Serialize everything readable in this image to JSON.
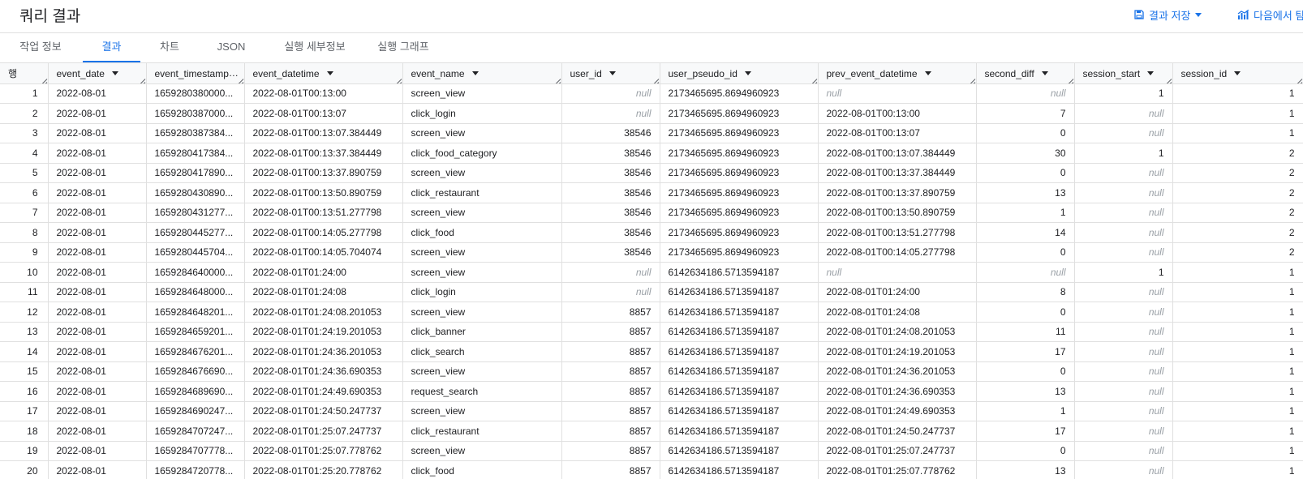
{
  "header": {
    "title": "쿼리 결과",
    "save_label": "결과 저장",
    "explore_label": "다음에서 탐색"
  },
  "tabs": [
    {
      "label": "작업 정보",
      "active": false
    },
    {
      "label": "결과",
      "active": true
    },
    {
      "label": "차트",
      "active": false
    },
    {
      "label": "JSON",
      "active": false
    },
    {
      "label": "실행 세부정보",
      "active": false
    },
    {
      "label": "실행 그래프",
      "active": false
    }
  ],
  "table": {
    "row_header": "행",
    "columns": [
      "event_date",
      "event_timestamp",
      "event_datetime",
      "event_name",
      "user_id",
      "user_pseudo_id",
      "prev_event_datetime",
      "second_diff",
      "session_start",
      "session_id"
    ],
    "rows": [
      [
        "1",
        "2022-08-01",
        "1659280380000...",
        "2022-08-01T00:13:00",
        "screen_view",
        "null",
        "2173465695.8694960923",
        "null",
        "null",
        "1",
        "1"
      ],
      [
        "2",
        "2022-08-01",
        "1659280387000...",
        "2022-08-01T00:13:07",
        "click_login",
        "null",
        "2173465695.8694960923",
        "2022-08-01T00:13:00",
        "7",
        "null",
        "1"
      ],
      [
        "3",
        "2022-08-01",
        "1659280387384...",
        "2022-08-01T00:13:07.384449",
        "screen_view",
        "38546",
        "2173465695.8694960923",
        "2022-08-01T00:13:07",
        "0",
        "null",
        "1"
      ],
      [
        "4",
        "2022-08-01",
        "1659280417384...",
        "2022-08-01T00:13:37.384449",
        "click_food_category",
        "38546",
        "2173465695.8694960923",
        "2022-08-01T00:13:07.384449",
        "30",
        "1",
        "2"
      ],
      [
        "5",
        "2022-08-01",
        "1659280417890...",
        "2022-08-01T00:13:37.890759",
        "screen_view",
        "38546",
        "2173465695.8694960923",
        "2022-08-01T00:13:37.384449",
        "0",
        "null",
        "2"
      ],
      [
        "6",
        "2022-08-01",
        "1659280430890...",
        "2022-08-01T00:13:50.890759",
        "click_restaurant",
        "38546",
        "2173465695.8694960923",
        "2022-08-01T00:13:37.890759",
        "13",
        "null",
        "2"
      ],
      [
        "7",
        "2022-08-01",
        "1659280431277...",
        "2022-08-01T00:13:51.277798",
        "screen_view",
        "38546",
        "2173465695.8694960923",
        "2022-08-01T00:13:50.890759",
        "1",
        "null",
        "2"
      ],
      [
        "8",
        "2022-08-01",
        "1659280445277...",
        "2022-08-01T00:14:05.277798",
        "click_food",
        "38546",
        "2173465695.8694960923",
        "2022-08-01T00:13:51.277798",
        "14",
        "null",
        "2"
      ],
      [
        "9",
        "2022-08-01",
        "1659280445704...",
        "2022-08-01T00:14:05.704074",
        "screen_view",
        "38546",
        "2173465695.8694960923",
        "2022-08-01T00:14:05.277798",
        "0",
        "null",
        "2"
      ],
      [
        "10",
        "2022-08-01",
        "1659284640000...",
        "2022-08-01T01:24:00",
        "screen_view",
        "null",
        "6142634186.5713594187",
        "null",
        "null",
        "1",
        "1"
      ],
      [
        "11",
        "2022-08-01",
        "1659284648000...",
        "2022-08-01T01:24:08",
        "click_login",
        "null",
        "6142634186.5713594187",
        "2022-08-01T01:24:00",
        "8",
        "null",
        "1"
      ],
      [
        "12",
        "2022-08-01",
        "1659284648201...",
        "2022-08-01T01:24:08.201053",
        "screen_view",
        "8857",
        "6142634186.5713594187",
        "2022-08-01T01:24:08",
        "0",
        "null",
        "1"
      ],
      [
        "13",
        "2022-08-01",
        "1659284659201...",
        "2022-08-01T01:24:19.201053",
        "click_banner",
        "8857",
        "6142634186.5713594187",
        "2022-08-01T01:24:08.201053",
        "11",
        "null",
        "1"
      ],
      [
        "14",
        "2022-08-01",
        "1659284676201...",
        "2022-08-01T01:24:36.201053",
        "click_search",
        "8857",
        "6142634186.5713594187",
        "2022-08-01T01:24:19.201053",
        "17",
        "null",
        "1"
      ],
      [
        "15",
        "2022-08-01",
        "1659284676690...",
        "2022-08-01T01:24:36.690353",
        "screen_view",
        "8857",
        "6142634186.5713594187",
        "2022-08-01T01:24:36.201053",
        "0",
        "null",
        "1"
      ],
      [
        "16",
        "2022-08-01",
        "1659284689690...",
        "2022-08-01T01:24:49.690353",
        "request_search",
        "8857",
        "6142634186.5713594187",
        "2022-08-01T01:24:36.690353",
        "13",
        "null",
        "1"
      ],
      [
        "17",
        "2022-08-01",
        "1659284690247...",
        "2022-08-01T01:24:50.247737",
        "screen_view",
        "8857",
        "6142634186.5713594187",
        "2022-08-01T01:24:49.690353",
        "1",
        "null",
        "1"
      ],
      [
        "18",
        "2022-08-01",
        "1659284707247...",
        "2022-08-01T01:25:07.247737",
        "click_restaurant",
        "8857",
        "6142634186.5713594187",
        "2022-08-01T01:24:50.247737",
        "17",
        "null",
        "1"
      ],
      [
        "19",
        "2022-08-01",
        "1659284707778...",
        "2022-08-01T01:25:07.778762",
        "screen_view",
        "8857",
        "6142634186.5713594187",
        "2022-08-01T01:25:07.247737",
        "0",
        "null",
        "1"
      ],
      [
        "20",
        "2022-08-01",
        "1659284720778...",
        "2022-08-01T01:25:20.778762",
        "click_food",
        "8857",
        "6142634186.5713594187",
        "2022-08-01T01:25:07.778762",
        "13",
        "null",
        "1"
      ]
    ]
  }
}
